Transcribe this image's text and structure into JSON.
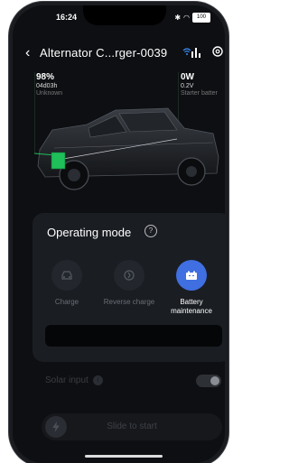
{
  "status_bar": {
    "time": "16:24",
    "battery": "100"
  },
  "header": {
    "title": "Alternator C...rger-0039"
  },
  "stats": {
    "left": {
      "percent": "98%",
      "duration": "04d03h",
      "status": "Unknown"
    },
    "right": {
      "power": "0W",
      "voltage": "0.2V",
      "label": "Starter batter"
    }
  },
  "operating_mode": {
    "title": "Operating mode",
    "modes": [
      {
        "label": "Charge",
        "active": false
      },
      {
        "label": "Reverse charge",
        "active": false
      },
      {
        "label": "Battery maintenance",
        "active": true
      }
    ]
  },
  "solar": {
    "label": "Solar input",
    "enabled": false
  },
  "slider": {
    "label": "Slide to start"
  },
  "colors": {
    "accent": "#3f6fe0",
    "wifi": "#3b8df5",
    "indicator": "#1fbf5a"
  },
  "icons": [
    "back-arrow-icon",
    "wifi-icon",
    "bar-chart-icon",
    "gear-icon",
    "help-icon",
    "car-icon",
    "reverse-charge-icon",
    "battery-icon",
    "info-icon",
    "bolt-icon"
  ]
}
